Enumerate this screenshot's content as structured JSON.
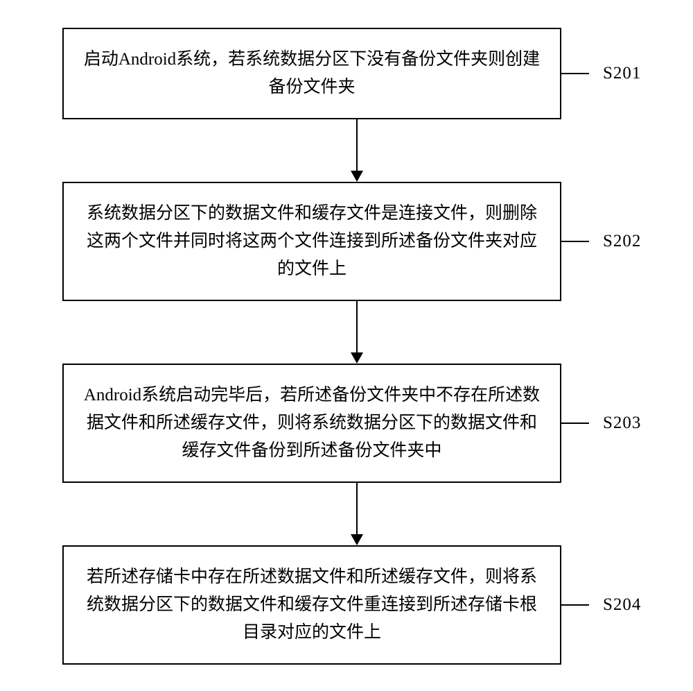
{
  "flowchart": {
    "steps": [
      {
        "id": "S201",
        "text": "启动Android系统，若系统数据分区下没有备份文件夹则创建备份文件夹"
      },
      {
        "id": "S202",
        "text": "系统数据分区下的数据文件和缓存文件是连接文件，则删除这两个文件并同时将这两个文件连接到所述备份文件夹对应的文件上"
      },
      {
        "id": "S203",
        "text": "Android系统启动完毕后，若所述备份文件夹中不存在所述数据文件和所述缓存文件，则将系统数据分区下的数据文件和缓存文件备份到所述备份文件夹中"
      },
      {
        "id": "S204",
        "text": "若所述存储卡中存在所述数据文件和所述缓存文件，则将系统数据分区下的数据文件和缓存文件重连接到所述存储卡根目录对应的文件上"
      }
    ]
  }
}
